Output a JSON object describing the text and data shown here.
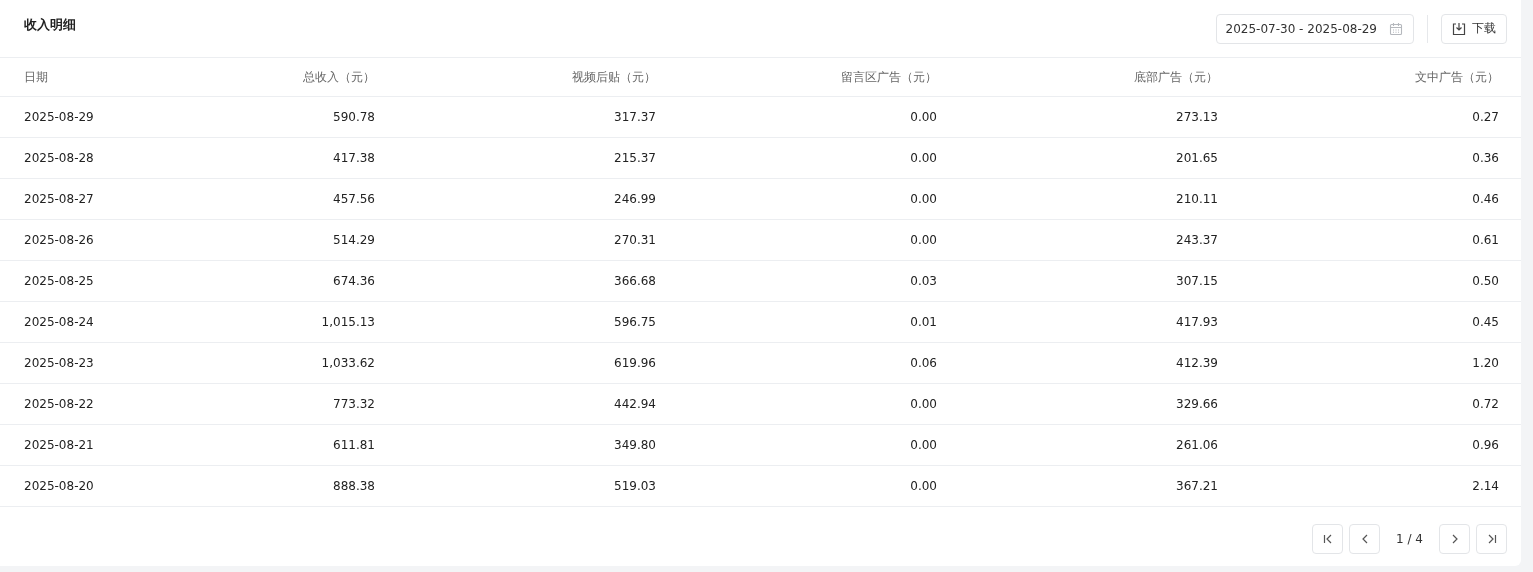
{
  "title": "收入明细",
  "date_range": {
    "value": "2025-07-30 - 2025-08-29"
  },
  "download_button": {
    "label": "下载"
  },
  "table": {
    "columns": [
      "日期",
      "总收入（元）",
      "视频后贴（元）",
      "留言区广告（元）",
      "底部广告（元）",
      "文中广告（元）"
    ],
    "rows": [
      [
        "2025-08-29",
        "590.78",
        "317.37",
        "0.00",
        "273.13",
        "0.27"
      ],
      [
        "2025-08-28",
        "417.38",
        "215.37",
        "0.00",
        "201.65",
        "0.36"
      ],
      [
        "2025-08-27",
        "457.56",
        "246.99",
        "0.00",
        "210.11",
        "0.46"
      ],
      [
        "2025-08-26",
        "514.29",
        "270.31",
        "0.00",
        "243.37",
        "0.61"
      ],
      [
        "2025-08-25",
        "674.36",
        "366.68",
        "0.03",
        "307.15",
        "0.50"
      ],
      [
        "2025-08-24",
        "1,015.13",
        "596.75",
        "0.01",
        "417.93",
        "0.45"
      ],
      [
        "2025-08-23",
        "1,033.62",
        "619.96",
        "0.06",
        "412.39",
        "1.20"
      ],
      [
        "2025-08-22",
        "773.32",
        "442.94",
        "0.00",
        "329.66",
        "0.72"
      ],
      [
        "2025-08-21",
        "611.81",
        "349.80",
        "0.00",
        "261.06",
        "0.96"
      ],
      [
        "2025-08-20",
        "888.38",
        "519.03",
        "0.00",
        "367.21",
        "2.14"
      ]
    ]
  },
  "pagination": {
    "page": "1 / 4"
  }
}
